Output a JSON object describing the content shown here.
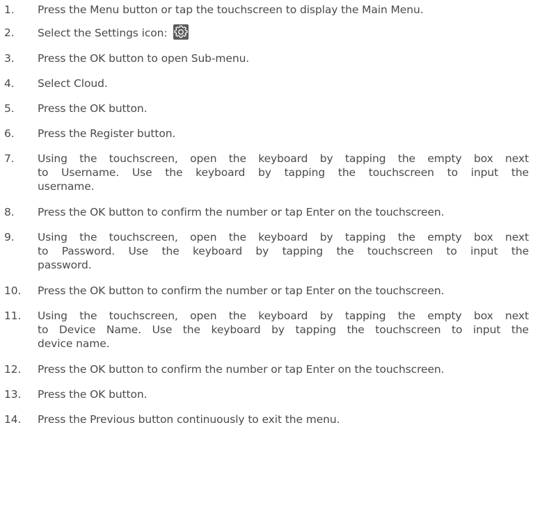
{
  "steps": [
    {
      "num": "1.",
      "text": "Press the Menu button or tap the touchscreen to display the Main Menu."
    },
    {
      "num": "2.",
      "text": "Select the Settings icon:",
      "icon": "settings-gear-icon"
    },
    {
      "num": "3.",
      "text": "Press the OK button to open Sub-menu."
    },
    {
      "num": "4.",
      "text": "Select Cloud."
    },
    {
      "num": "5.",
      "text": "Press the OK button."
    },
    {
      "num": "6.",
      "text": "Press the Register button."
    },
    {
      "num": "7.",
      "lines": [
        "Using the touchscreen, open the keyboard by tapping the empty box next",
        "to Username. Use the keyboard by tapping the touchscreen to input the",
        "username."
      ]
    },
    {
      "num": "8.",
      "text": "Press the OK button to confirm the number or tap Enter on the touchscreen."
    },
    {
      "num": "9.",
      "lines": [
        "Using the touchscreen, open the keyboard by tapping the empty box next",
        "to Password. Use the keyboard by tapping the touchscreen to input the",
        "password."
      ]
    },
    {
      "num": "10.",
      "text": "Press the OK button to confirm the number or tap Enter on the touchscreen."
    },
    {
      "num": "11.",
      "lines": [
        "Using the touchscreen, open the keyboard by tapping the empty box next",
        "to Device Name. Use the keyboard by tapping the touchscreen to input the",
        "device name."
      ]
    },
    {
      "num": "12.",
      "text": "Press the OK button to confirm the number or tap Enter on the touchscreen."
    },
    {
      "num": "13.",
      "text": "Press the OK button."
    },
    {
      "num": "14.",
      "text": "Press the Previous button continuously to exit the menu."
    }
  ],
  "colors": {
    "text": "#4a4a4a",
    "icon_background": "#5a5a5a",
    "icon_foreground": "#ffffff"
  }
}
